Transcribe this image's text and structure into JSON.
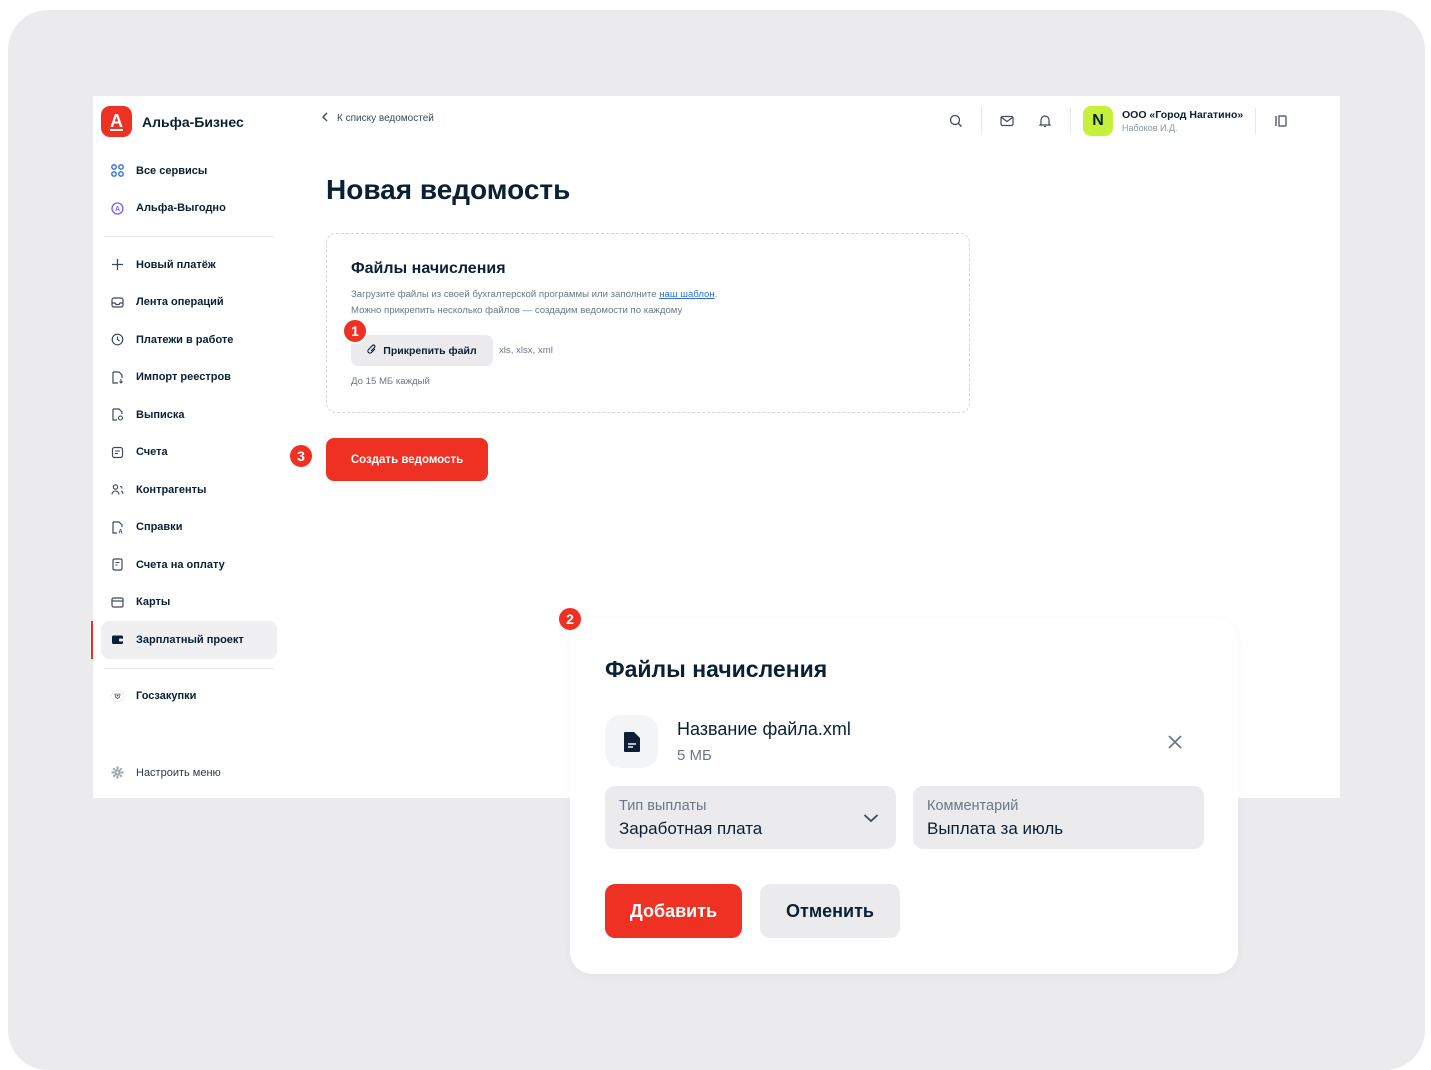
{
  "brand": {
    "name": "Альфа-Бизнес",
    "logo_letter": "А",
    "accent": "#ef3124"
  },
  "sidebar": {
    "top_items": [
      {
        "label": "Все сервисы",
        "icon": "grid-icon"
      },
      {
        "label": "Альфа-Выгодно",
        "icon": "alfa-circle-icon"
      }
    ],
    "items": [
      {
        "label": "Новый платёж",
        "icon": "plus-icon"
      },
      {
        "label": "Лента операций",
        "icon": "inbox-icon"
      },
      {
        "label": "Платежи в работе",
        "icon": "clock-icon"
      },
      {
        "label": "Импорт реестров",
        "icon": "doc-import-icon"
      },
      {
        "label": "Выписка",
        "icon": "doc-statement-icon"
      },
      {
        "label": "Счета",
        "icon": "account-icon"
      },
      {
        "label": "Контрагенты",
        "icon": "people-icon"
      },
      {
        "label": "Справки",
        "icon": "doc-reference-icon"
      },
      {
        "label": "Счета на оплату",
        "icon": "invoice-icon"
      },
      {
        "label": "Карты",
        "icon": "card-icon"
      },
      {
        "label": "Зарплатный проект",
        "icon": "wallet-icon",
        "active": true
      }
    ],
    "bottom_items": [
      {
        "label": "Госзакупки",
        "icon": "emblem-icon"
      }
    ],
    "settings_label": "Настроить меню"
  },
  "header": {
    "back_label": "К списку ведомостей",
    "org_name": "ООО «Город Нагатино»",
    "org_user": "Набоков И.Д.",
    "org_avatar_letter": "N"
  },
  "page": {
    "title": "Новая ведомость",
    "upload": {
      "title": "Файлы начисления",
      "desc_prefix": "Загрузите файлы из своей бухгалтерской программы или заполните ",
      "desc_link": "наш шаблон",
      "desc_suffix": ".",
      "desc_line2": "Можно прикрепить несколько файлов — создадим ведомости по каждому",
      "attach_label": "Прикрепить файл",
      "formats": "xls, xlsx, xml",
      "limit": "До 15 МБ каждый"
    },
    "create_label": "Создать ведомость"
  },
  "badges": {
    "b1": "1",
    "b2": "2",
    "b3": "3"
  },
  "modal": {
    "title": "Файлы начисления",
    "file_name": "Название файла.xml",
    "file_size": "5 МБ",
    "payment_type": {
      "label": "Тип выплаты",
      "value": "Заработная плата"
    },
    "comment": {
      "label": "Комментарий",
      "value": "Выплата за июль"
    },
    "add_label": "Добавить",
    "cancel_label": "Отменить"
  }
}
